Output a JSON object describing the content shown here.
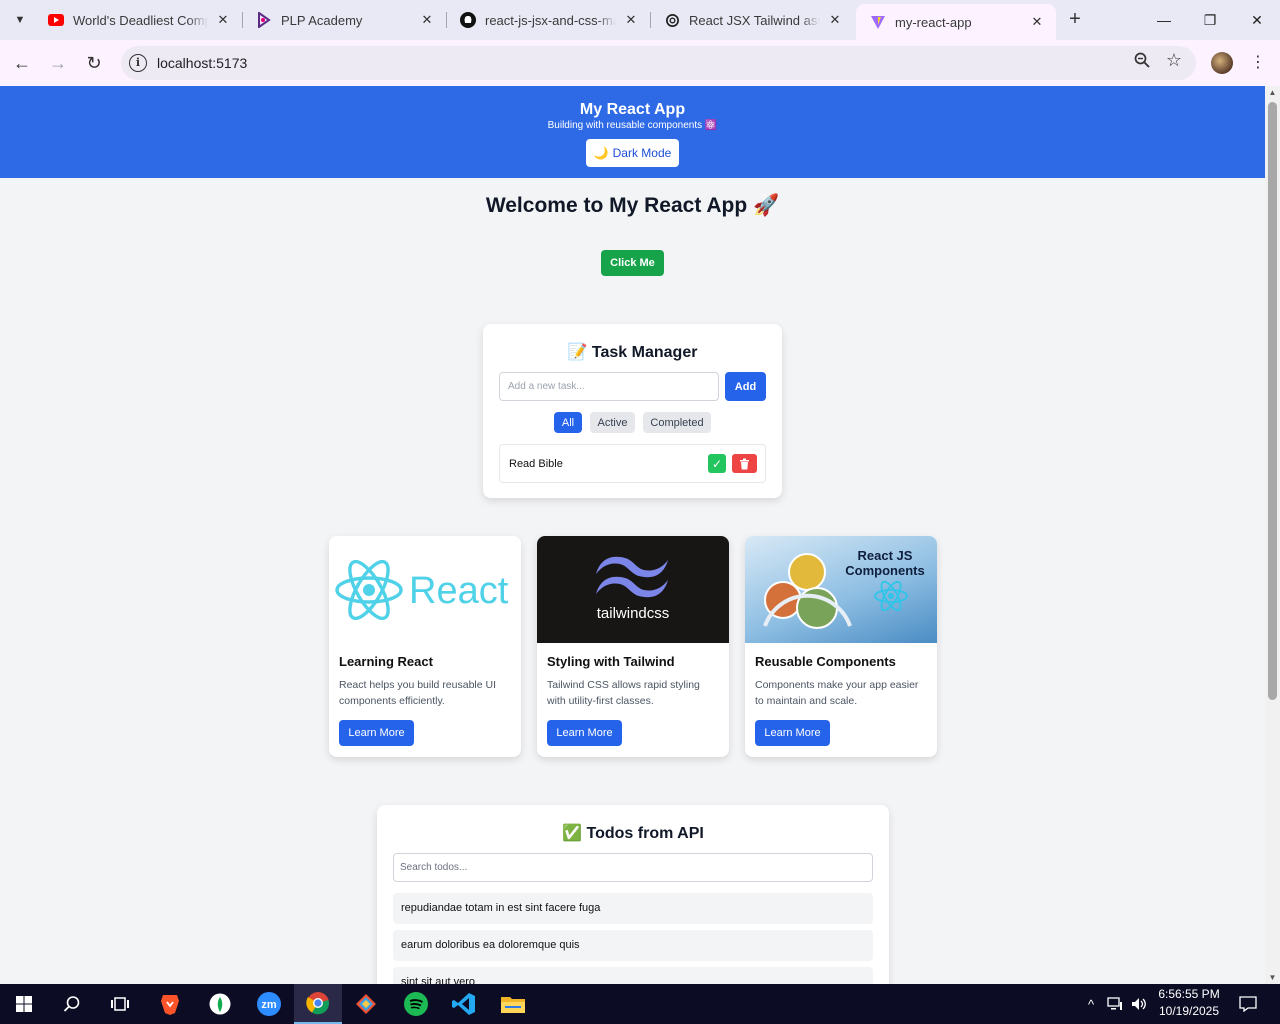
{
  "browser": {
    "tabs": [
      {
        "title": "World's Deadliest Compu",
        "favicon": "youtube-icon"
      },
      {
        "title": "PLP Academy",
        "favicon": "plp-icon"
      },
      {
        "title": "react-js-jsx-and-css-mast",
        "favicon": "github-icon"
      },
      {
        "title": "React JSX Tailwind assign",
        "favicon": "chatgpt-icon"
      },
      {
        "title": "my-react-app",
        "favicon": "vite-icon"
      }
    ],
    "url": "localhost:5173"
  },
  "header": {
    "title": "My React App",
    "subtitle": "Building with reusable components ⚛️",
    "dark_mode_label": "Dark Mode",
    "dark_mode_icon": "🌙",
    "accent": "#2f6ae6"
  },
  "main": {
    "welcome": "Welcome to My React App 🚀",
    "click_label": "Click Me"
  },
  "task_manager": {
    "title": "📝 Task Manager",
    "placeholder": "Add a new task...",
    "add_label": "Add",
    "filters": [
      "All",
      "Active",
      "Completed"
    ],
    "active_filter": "All",
    "tasks": [
      {
        "text": "Read Bible",
        "check": "✓"
      }
    ]
  },
  "feature_cards": [
    {
      "image_label": "React",
      "title": "Learning React",
      "text": "React helps you build reusable UI components efficiently.",
      "button": "Learn More"
    },
    {
      "image_label": "tailwindcss",
      "title": "Styling with Tailwind",
      "text": "Tailwind CSS allows rapid styling with utility-first classes.",
      "button": "Learn More"
    },
    {
      "image_label": "React JS Components",
      "title": "Reusable Components",
      "text": "Components make your app easier to maintain and scale.",
      "button": "Learn More"
    }
  ],
  "todos": {
    "title": "✅ Todos from API",
    "search_placeholder": "Search todos...",
    "items": [
      "repudiandae totam in est sint facere fuga",
      "earum doloribus ea doloremque quis",
      "sint sit aut vero"
    ]
  },
  "taskbar": {
    "time": "6:56:55 PM",
    "date": "10/19/2025"
  }
}
